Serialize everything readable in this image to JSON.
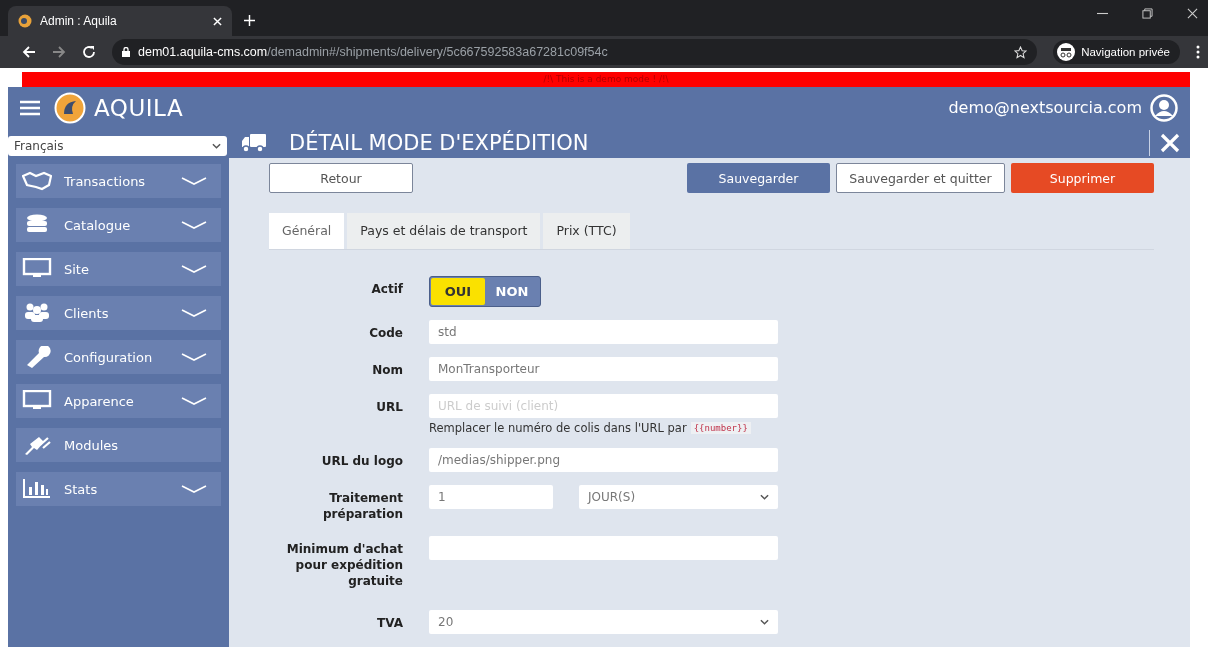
{
  "browser": {
    "tab_title": "Admin : Aquila",
    "url_host": "dem01.aquila-cms.com",
    "url_path": "/demadmin#/shipments/delivery/5c667592583a67281c09f54c",
    "profile": "Navigation privée"
  },
  "demo_banner": "/!\\ This is a demo mode ! /!\\",
  "header": {
    "brand": "AQUILA",
    "user": "demo@nextsourcia.com"
  },
  "sidebar": {
    "language": "Français",
    "items": [
      {
        "label": "Transactions",
        "expandable": true
      },
      {
        "label": "Catalogue",
        "expandable": true
      },
      {
        "label": "Site",
        "expandable": true
      },
      {
        "label": "Clients",
        "expandable": true
      },
      {
        "label": "Configuration",
        "expandable": true
      },
      {
        "label": "Apparence",
        "expandable": true
      },
      {
        "label": "Modules",
        "expandable": false
      },
      {
        "label": "Stats",
        "expandable": true
      }
    ]
  },
  "page_title": "DÉTAIL MODE D'EXPÉDITION",
  "actions": {
    "back": "Retour",
    "save": "Sauvegarder",
    "save_quit": "Sauvegarder et quitter",
    "delete": "Supprimer"
  },
  "tabs": [
    {
      "label": "Général",
      "selected": true
    },
    {
      "label": "Pays et délais de transport",
      "selected": false
    },
    {
      "label": "Prix (TTC)",
      "selected": false
    }
  ],
  "form": [
    {
      "kind": "toggle",
      "label": "Actif",
      "on_label": "OUI",
      "off_label": "NON",
      "on": true
    },
    {
      "kind": "text",
      "label": "Code",
      "value": "std"
    },
    {
      "kind": "text",
      "label": "Nom",
      "value": "MonTransporteur"
    },
    {
      "kind": "text",
      "label": "URL",
      "placeholder": "URL de suivi (client)",
      "hint": "Remplacer le numéro de colis dans l'URL par",
      "hint_code": "{{number}}"
    },
    {
      "kind": "text",
      "label": "URL du logo",
      "value": "/medias/shipper.png"
    },
    {
      "kind": "pair",
      "label": "Traitement préparation",
      "value": "1",
      "unit": "JOUR(S)"
    },
    {
      "kind": "text",
      "label": "Minimum d'achat pour expédition gratuite"
    },
    {
      "kind": "select",
      "label": "TVA",
      "value": "20"
    }
  ]
}
